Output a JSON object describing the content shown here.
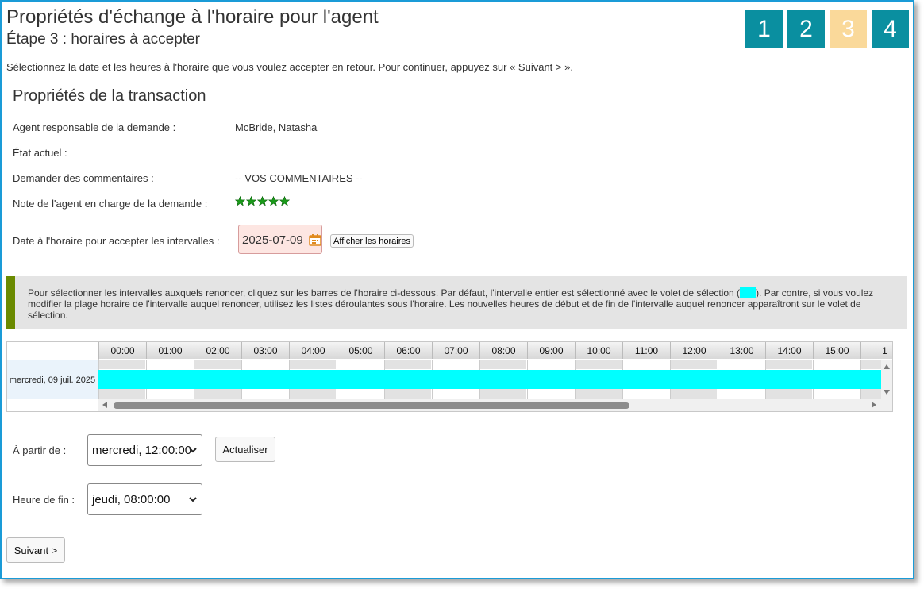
{
  "header": {
    "title": "Propriétés d'échange à l'horaire pour l'agent",
    "subtitle": "Étape 3 : horaires à accepter",
    "steps": [
      "1",
      "2",
      "3",
      "4"
    ],
    "active_step": "3"
  },
  "instruction": "Sélectionnez la date et les heures à l'horaire que vous voulez accepter en retour. Pour continuer, appuyez sur « Suivant > ».",
  "transaction": {
    "title": "Propriétés de la transaction",
    "agent_label": "Agent responsable de la demande :",
    "agent_value": "McBride, Natasha",
    "state_label": "État actuel :",
    "comments_label": "Demander des commentaires :",
    "comments_value": "-- VOS COMMENTAIRES --",
    "rating_label": "Note de l'agent en charge de la demande :",
    "rating_stars": 5,
    "date_label": "Date à l'horaire pour accepter les intervalles :",
    "date_value": "2025-07-09",
    "show_button": "Afficher les horaires"
  },
  "info": {
    "text_before": "Pour sélectionner les intervalles auxquels renoncer, cliquez sur les barres de l'horaire ci-dessous. Par défaut, l'intervalle entier est sélectionné avec le volet de sélection (",
    "text_after": "). Par contre, si vous voulez modifier la plage horaire de l'intervalle auquel renoncer, utilisez les listes déroulantes sous l'horaire. Les nouvelles heures de début et de fin de l'intervalle auquel renoncer apparaîtront sur le volet de sélection.",
    "swatch_color": "#00ffff"
  },
  "schedule": {
    "hours": [
      "00:00",
      "01:00",
      "02:00",
      "03:00",
      "04:00",
      "05:00",
      "06:00",
      "07:00",
      "08:00",
      "09:00",
      "10:00",
      "11:00",
      "12:00",
      "13:00",
      "14:00",
      "15:00",
      "1"
    ],
    "row_label": "mercredi, 09 juil. 2025"
  },
  "form": {
    "from_label": "À partir de :",
    "from_value": "mercredi, 12:00:00",
    "refresh_button": "Actualiser",
    "end_label": "Heure de fin :",
    "end_value": "jeudi, 08:00:00",
    "next_button": "Suivant >"
  }
}
